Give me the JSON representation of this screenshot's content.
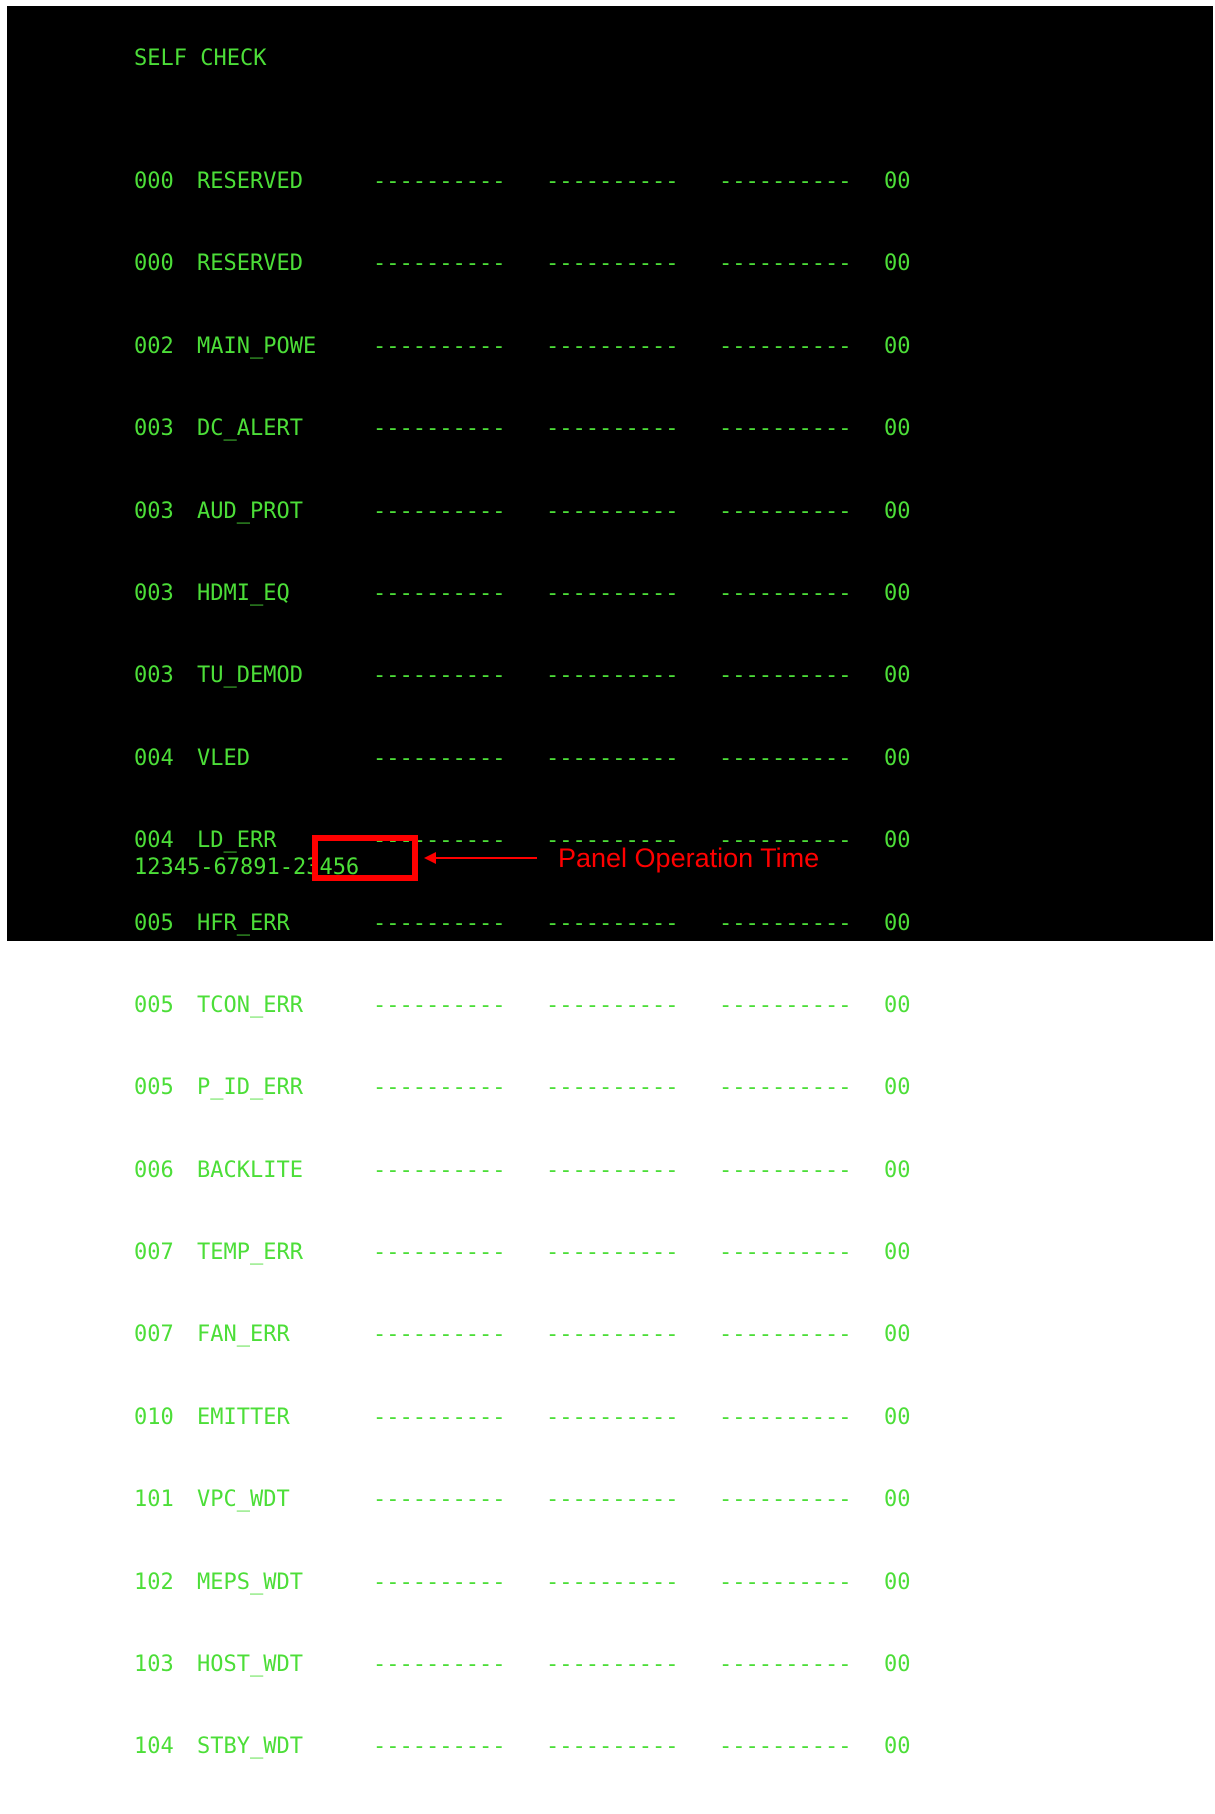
{
  "screen": {
    "title": "SELF CHECK",
    "rows": [
      {
        "code": "000",
        "name": "RESERVED",
        "c1": "----------",
        "c2": "----------",
        "c3": "----------",
        "value": "00"
      },
      {
        "code": "000",
        "name": "RESERVED",
        "c1": "----------",
        "c2": "----------",
        "c3": "----------",
        "value": "00"
      },
      {
        "code": "002",
        "name": "MAIN_POWE",
        "c1": "----------",
        "c2": "----------",
        "c3": "----------",
        "value": "00"
      },
      {
        "code": "003",
        "name": "DC_ALERT",
        "c1": "----------",
        "c2": "----------",
        "c3": "----------",
        "value": "00"
      },
      {
        "code": "003",
        "name": "AUD_PROT",
        "c1": "----------",
        "c2": "----------",
        "c3": "----------",
        "value": "00"
      },
      {
        "code": "003",
        "name": "HDMI_EQ",
        "c1": "----------",
        "c2": "----------",
        "c3": "----------",
        "value": "00"
      },
      {
        "code": "003",
        "name": "TU_DEMOD",
        "c1": "----------",
        "c2": "----------",
        "c3": "----------",
        "value": "00"
      },
      {
        "code": "004",
        "name": "VLED",
        "c1": "----------",
        "c2": "----------",
        "c3": "----------",
        "value": "00"
      },
      {
        "code": "004",
        "name": "LD_ERR",
        "c1": "----------",
        "c2": "----------",
        "c3": "----------",
        "value": "00"
      },
      {
        "code": "005",
        "name": "HFR_ERR",
        "c1": "----------",
        "c2": "----------",
        "c3": "----------",
        "value": "00"
      },
      {
        "code": "005",
        "name": "TCON_ERR",
        "c1": "----------",
        "c2": "----------",
        "c3": "----------",
        "value": "00"
      },
      {
        "code": "005",
        "name": "P_ID_ERR",
        "c1": "----------",
        "c2": "----------",
        "c3": "----------",
        "value": "00"
      },
      {
        "code": "006",
        "name": "BACKLITE",
        "c1": "----------",
        "c2": "----------",
        "c3": "----------",
        "value": "00"
      },
      {
        "code": "007",
        "name": "TEMP_ERR",
        "c1": "----------",
        "c2": "----------",
        "c3": "----------",
        "value": "00"
      },
      {
        "code": "007",
        "name": "FAN_ERR",
        "c1": "----------",
        "c2": "----------",
        "c3": "----------",
        "value": "00"
      },
      {
        "code": "010",
        "name": "EMITTER",
        "c1": "----------",
        "c2": "----------",
        "c3": "----------",
        "value": "00"
      },
      {
        "code": "101",
        "name": "VPC_WDT",
        "c1": "----------",
        "c2": "----------",
        "c3": "----------",
        "value": "00"
      },
      {
        "code": "102",
        "name": "MEPS_WDT",
        "c1": "----------",
        "c2": "----------",
        "c3": "----------",
        "value": "00"
      },
      {
        "code": "103",
        "name": "HOST_WDT",
        "c1": "----------",
        "c2": "----------",
        "c3": "----------",
        "value": "00"
      },
      {
        "code": "104",
        "name": "STBY_WDT",
        "c1": "----------",
        "c2": "----------",
        "c3": "----------",
        "value": "00"
      }
    ],
    "footer": {
      "prefix": "12345-67891-",
      "operation_time": "23456"
    }
  },
  "annotation": {
    "label": "Panel Operation Time",
    "color": "#ff0000"
  },
  "colors": {
    "text": "#4cde38",
    "background": "#000000"
  }
}
